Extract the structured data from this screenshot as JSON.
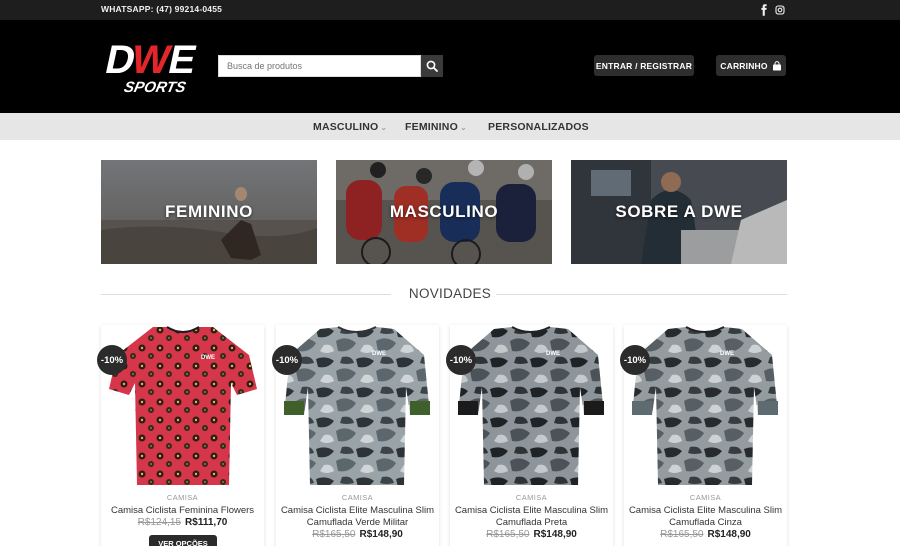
{
  "topbar": {
    "phone": "WHATSAPP: (47) 99214-0455",
    "social": [
      "facebook-icon",
      "instagram-icon"
    ]
  },
  "header": {
    "logo_text": "DWE",
    "logo_sub": "SPORTS",
    "search_placeholder": "Busca de produtos",
    "login_label": "ENTRAR / REGISTRAR",
    "cart_label": "CARRINHO"
  },
  "nav": {
    "items": [
      {
        "label": "MASCULINO",
        "dropdown": true
      },
      {
        "label": "FEMININO",
        "dropdown": true
      },
      {
        "label": "PERSONALIZADOS",
        "dropdown": false
      }
    ]
  },
  "banners": [
    {
      "label": "FEMININO"
    },
    {
      "label": "MASCULINO"
    },
    {
      "label": "SOBRE A DWE"
    }
  ],
  "section": {
    "title": "NOVIDADES"
  },
  "products": [
    {
      "badge": "-10%",
      "category": "CAMISA",
      "name": "Camisa Ciclista Feminina Flowers",
      "old_price": "R$124,15",
      "new_price": "R$111,70",
      "button": "VER OPÇÕES"
    },
    {
      "badge": "-10%",
      "category": "CAMISA",
      "name": "Camisa Ciclista Elite Masculina Slim Camuflada Verde Militar",
      "old_price": "R$165,50",
      "new_price": "R$148,90"
    },
    {
      "badge": "-10%",
      "category": "CAMISA",
      "name": "Camisa Ciclista Elite Masculina Slim Camuflada Preta",
      "old_price": "R$165,50",
      "new_price": "R$148,90"
    },
    {
      "badge": "-10%",
      "category": "CAMISA",
      "name": "Camisa Ciclista Elite Masculina Slim Camuflada Cinza",
      "old_price": "R$165,50",
      "new_price": "R$148,90"
    }
  ],
  "colors": {
    "header_bg": "#000000",
    "topbar_bg": "#1e1e1e",
    "nav_bg": "#e6e6e6",
    "logo_accent": "#e3262c",
    "badge_bg": "#2b2b2b"
  }
}
